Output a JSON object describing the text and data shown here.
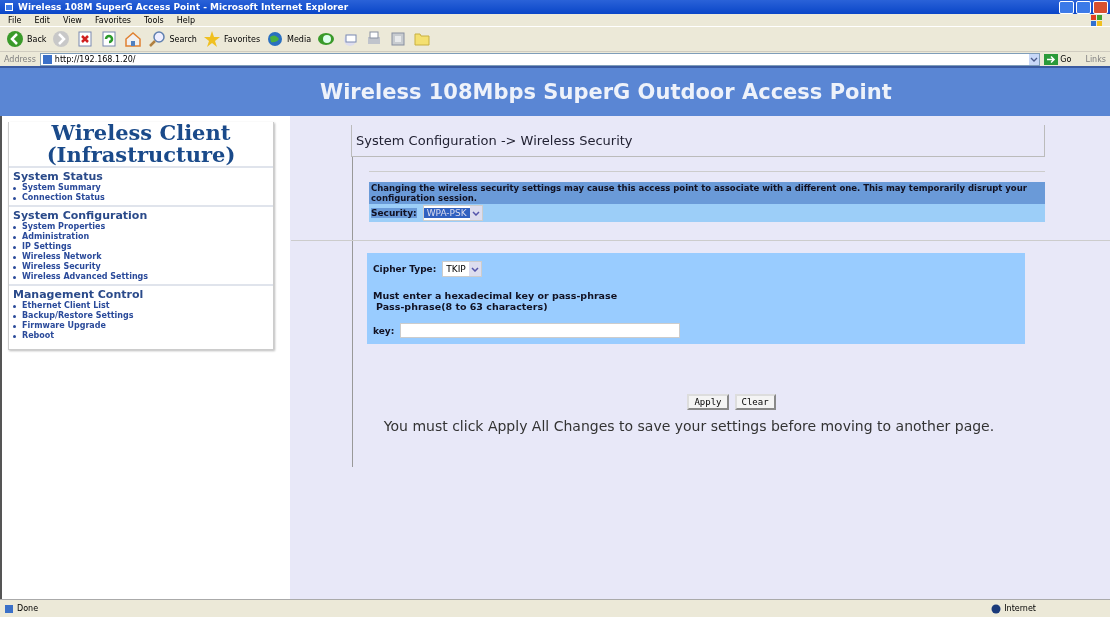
{
  "window": {
    "title": "Wireless 108M SuperG Access Point - Microsoft Internet Explorer"
  },
  "menu": [
    "File",
    "Edit",
    "View",
    "Favorites",
    "Tools",
    "Help"
  ],
  "toolbar": [
    {
      "kind": "back",
      "label": "Back"
    },
    {
      "kind": "forward"
    },
    {
      "kind": "stop"
    },
    {
      "kind": "refresh"
    },
    {
      "kind": "home"
    },
    {
      "kind": "search",
      "label": "Search"
    },
    {
      "kind": "favorites",
      "label": "Favorites"
    },
    {
      "kind": "media",
      "label": "Media"
    },
    {
      "kind": "history"
    },
    {
      "kind": "mail"
    },
    {
      "kind": "print"
    },
    {
      "kind": "edit"
    },
    {
      "kind": "folder"
    }
  ],
  "address": {
    "label": "Address",
    "value": "http://192.168.1.20/",
    "go": "Go",
    "links": "Links"
  },
  "banner": {
    "title": "Wireless 108Mbps SuperG Outdoor Access Point"
  },
  "sidebar": {
    "title": "Wireless Client (Infrastructure)",
    "sections": [
      {
        "heading": "System Status",
        "items": [
          "System Summary",
          "Connection Status"
        ]
      },
      {
        "heading": "System Configuration",
        "items": [
          "System Properties",
          "Administration",
          "IP Settings",
          "Wireless Network",
          "Wireless Security",
          "Wireless Advanced Settings"
        ]
      },
      {
        "heading": "Management Control",
        "items": [
          "Ethernet Client List",
          "Backup/Restore Settings",
          "Firmware Upgrade",
          "Reboot"
        ]
      }
    ]
  },
  "main": {
    "breadcrumb": "System Configuration -> Wireless Security",
    "notice": "Changing the wireless security settings may cause this access point to associate with a different one. This may temporarily disrupt your configuration session.",
    "security": {
      "label": "Security:",
      "value": "WPA-PSK"
    },
    "cipher": {
      "label": "Cipher Type:",
      "value": "TKIP"
    },
    "hints": [
      "Must enter a hexadecimal key or pass-phrase",
      "Pass-phrase(8 to 63 characters)"
    ],
    "key": {
      "label": "key:"
    },
    "buttons": [
      "Apply",
      "Clear"
    ],
    "note": "You must click Apply All Changes to save your settings before moving to another page."
  },
  "status_bar": {
    "text": "Done",
    "zone": "Internet"
  }
}
